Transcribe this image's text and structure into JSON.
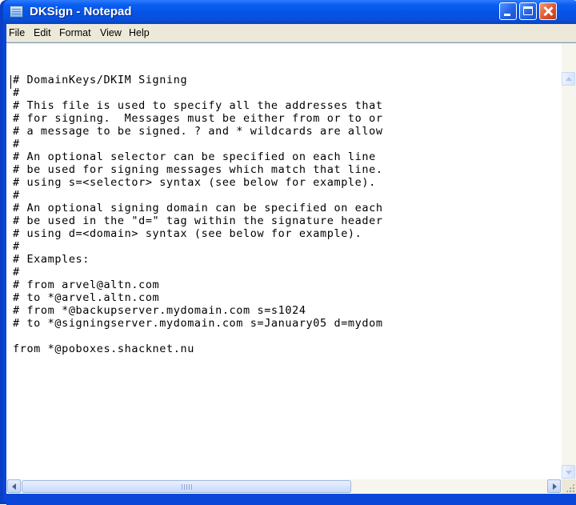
{
  "window": {
    "title": "DKSign - Notepad"
  },
  "menubar": {
    "items": [
      "File",
      "Edit",
      "Format",
      "View",
      "Help"
    ]
  },
  "editor": {
    "lines": [
      "# DomainKeys/DKIM Signing",
      "#",
      "# This file is used to specify all the addresses that",
      "# for signing.  Messages must be either from or to or",
      "# a message to be signed. ? and * wildcards are allow",
      "#",
      "# An optional selector can be specified on each line",
      "# be used for signing messages which match that line.",
      "# using s=<selector> syntax (see below for example).",
      "#",
      "# An optional signing domain can be specified on each",
      "# be used in the \"d=\" tag within the signature header",
      "# using d=<domain> syntax (see below for example).",
      "#",
      "# Examples:",
      "#",
      "# from arvel@altn.com",
      "# to *@arvel.altn.com",
      "# from *@backupserver.mydomain.com s=s1024",
      "# to *@signingserver.mydomain.com s=January05 d=mydom",
      "",
      "from *@poboxes.shacknet.nu"
    ]
  },
  "colors": {
    "titlebar": "#0554e8",
    "menubar": "#ece9d8",
    "close_button": "#e0552d"
  },
  "icons": [
    "notepad-app-icon",
    "minimize-icon",
    "maximize-icon",
    "close-icon",
    "scroll-up-icon",
    "scroll-down-icon",
    "scroll-left-icon",
    "scroll-right-icon",
    "size-grip-icon"
  ]
}
